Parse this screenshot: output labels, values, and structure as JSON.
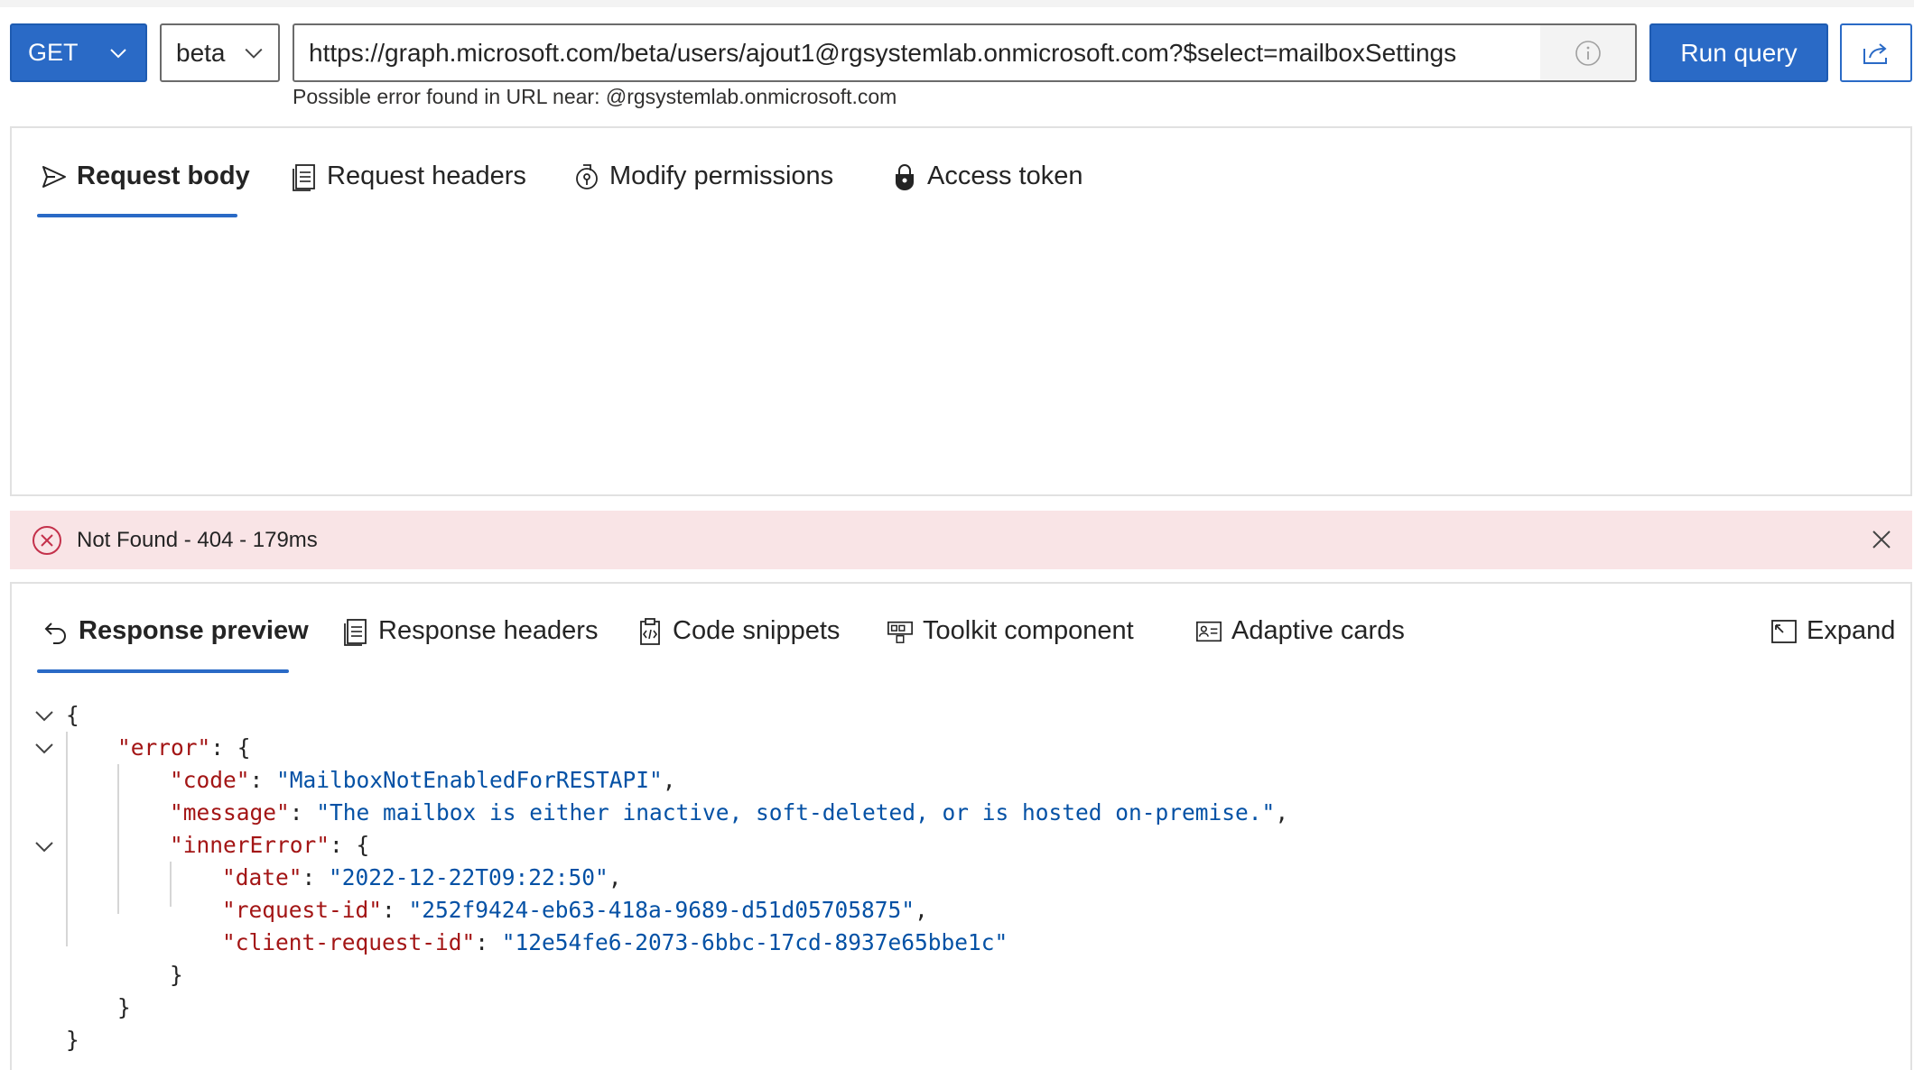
{
  "toolbar": {
    "method": "GET",
    "version": "beta",
    "url": "https://graph.microsoft.com/beta/users/ajout1@rgsystemlab.onmicrosoft.com?$select=mailboxSettings",
    "run_label": "Run query",
    "url_error": "Possible error found in URL near: @rgsystemlab.onmicrosoft.com"
  },
  "request_tabs": [
    {
      "label": "Request body",
      "icon": "send-icon",
      "active": true
    },
    {
      "label": "Request headers",
      "icon": "document-icon",
      "active": false
    },
    {
      "label": "Modify permissions",
      "icon": "permission-icon",
      "active": false
    },
    {
      "label": "Access token",
      "icon": "lock-icon",
      "active": false
    }
  ],
  "status": {
    "text": "Not Found - 404 - 179ms",
    "icon": "error-circle-icon",
    "color": "#f9e4e6"
  },
  "response_tabs": [
    {
      "label": "Response preview",
      "icon": "undo-icon",
      "active": true
    },
    {
      "label": "Response headers",
      "icon": "document-icon",
      "active": false
    },
    {
      "label": "Code snippets",
      "icon": "clipboard-code-icon",
      "active": false
    },
    {
      "label": "Toolkit component",
      "icon": "toolkit-icon",
      "active": false
    },
    {
      "label": "Adaptive cards",
      "icon": "contact-card-icon",
      "active": false
    }
  ],
  "expand_label": "Expand",
  "response_json": {
    "open_brace": "{",
    "error_key": "\"error\"",
    "code_key": "\"code\"",
    "code_value": "\"MailboxNotEnabledForRESTAPI\"",
    "message_key": "\"message\"",
    "message_value": "\"The mailbox is either inactive, soft-deleted, or is hosted on-premise.\"",
    "inner_key": "\"innerError\"",
    "date_key": "\"date\"",
    "date_value": "\"2022-12-22T09:22:50\"",
    "request_id_key": "\"request-id\"",
    "request_id_value": "\"252f9424-eb63-418a-9689-d51d05705875\"",
    "client_request_id_key": "\"client-request-id\"",
    "client_request_id_value": "\"12e54fe6-2073-6bbc-17cd-8937e65bbe1c\"",
    "close_brace": "}"
  },
  "colors": {
    "accent": "#2a6ac6",
    "json_key": "#a31515",
    "json_value": "#0451a5"
  }
}
